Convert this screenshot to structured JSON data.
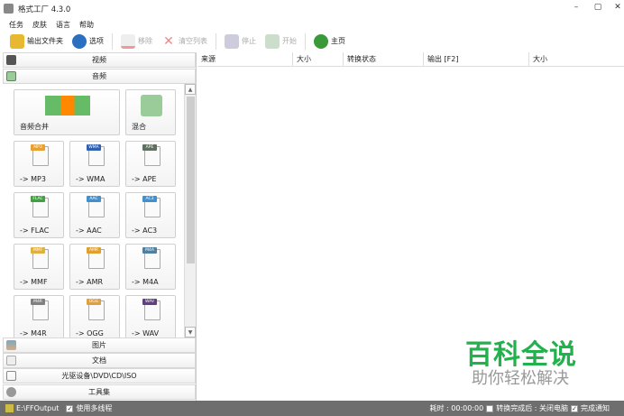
{
  "app": {
    "title": "格式工厂 4.3.0"
  },
  "menu": [
    "任务",
    "皮肤",
    "语言",
    "帮助"
  ],
  "toolbar": {
    "output_folder": "输出文件夹",
    "options": "选项",
    "remove": "移除",
    "clear_list": "清空列表",
    "stop": "停止",
    "start": "开始",
    "home": "主页"
  },
  "categories": {
    "video": "视频",
    "audio": "音频",
    "picture": "图片",
    "document": "文档",
    "optical": "光驱设备\\DVD\\CD\\ISO",
    "tools": "工具集"
  },
  "audio_tiles": {
    "merge": "音频合并",
    "mix": "混合",
    "items": [
      {
        "label": "-> MP3",
        "tag": "MP3",
        "color": "#e8a030"
      },
      {
        "label": "-> WMA",
        "tag": "WMA",
        "color": "#3060b0"
      },
      {
        "label": "-> APE",
        "tag": "APE",
        "color": "#607060"
      },
      {
        "label": "-> FLAC",
        "tag": "FLAC",
        "color": "#40a040"
      },
      {
        "label": "-> AAC",
        "tag": "AAC",
        "color": "#4090d0"
      },
      {
        "label": "-> AC3",
        "tag": "AC3",
        "color": "#4090d0"
      },
      {
        "label": "-> MMF",
        "tag": "MMF",
        "color": "#e0b040"
      },
      {
        "label": "-> AMR",
        "tag": "AMR",
        "color": "#e0a030"
      },
      {
        "label": "-> M4A",
        "tag": "M4A",
        "color": "#5080a0"
      },
      {
        "label": "-> M4R",
        "tag": "M4R",
        "color": "#808080"
      },
      {
        "label": "-> OGG",
        "tag": "OGG",
        "color": "#e0a040"
      },
      {
        "label": "-> WAV",
        "tag": "WAV",
        "color": "#604080"
      }
    ]
  },
  "table": {
    "columns": [
      "来源",
      "大小",
      "转换状态",
      "输出 [F2]",
      "大小"
    ]
  },
  "status": {
    "output_path": "E:\\FFOutput",
    "multithread": "使用多线程",
    "elapsed": "耗时 : 00:00:00",
    "shutdown": "转换完成后 : 关闭电脑",
    "notify": "完成通知"
  },
  "watermark": {
    "title": "百科全说",
    "subtitle": "助你轻松解决"
  }
}
